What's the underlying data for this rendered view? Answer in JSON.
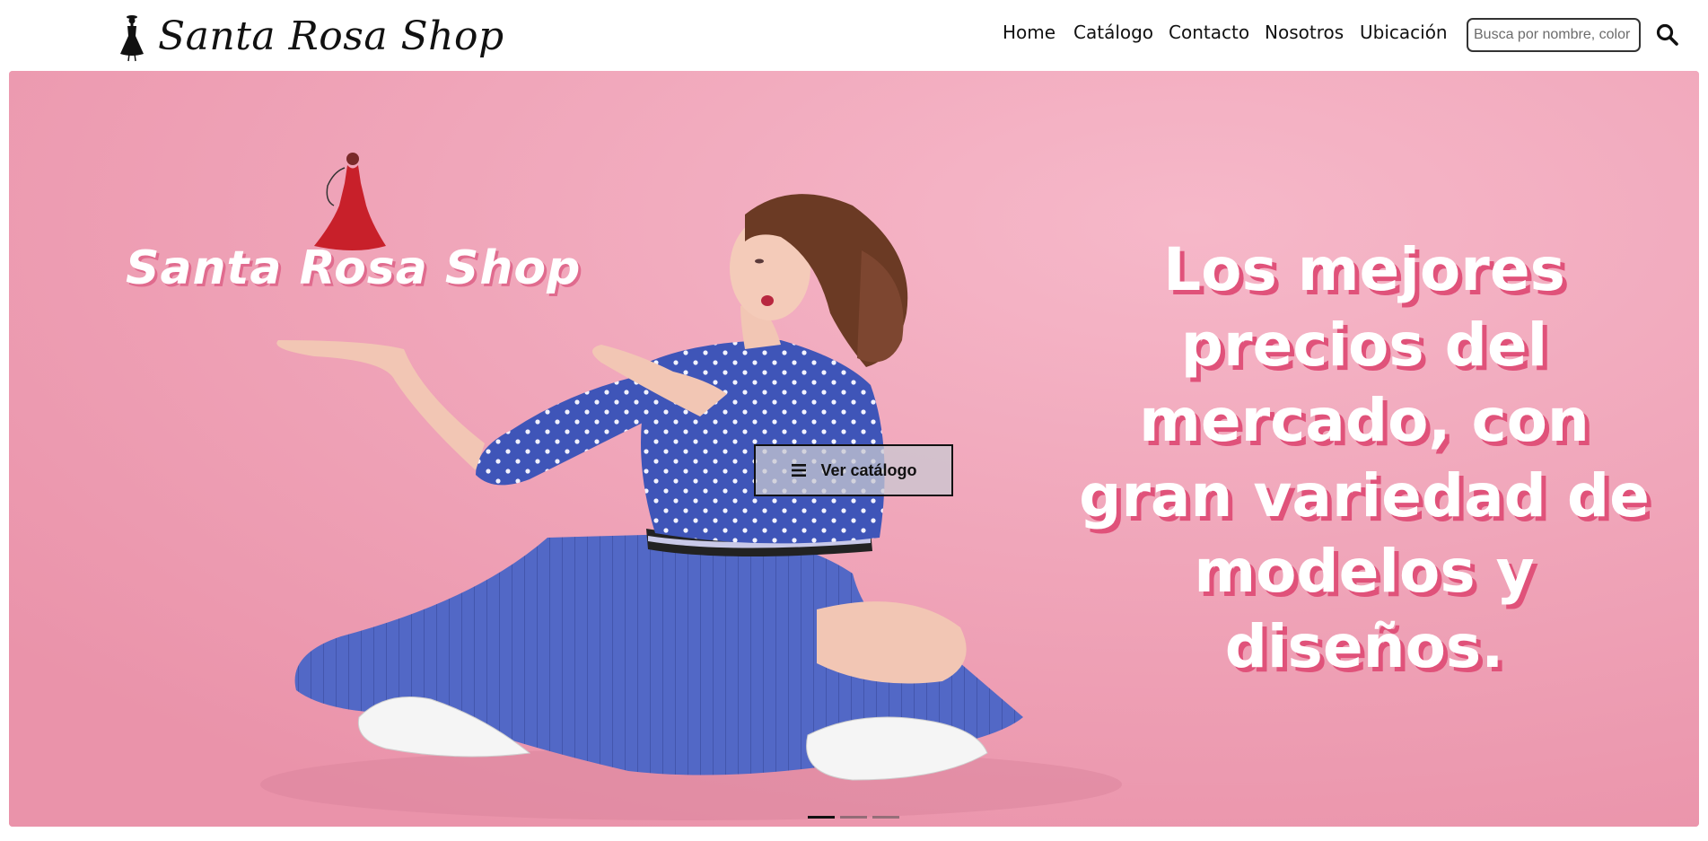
{
  "navbar": {
    "brand_name": "Santa Rosa Shop",
    "links": [
      "Home",
      "Catálogo",
      "Contacto",
      "Nosotros",
      "Ubicación"
    ],
    "search": {
      "placeholder": "Busca por nombre, color",
      "value": ""
    }
  },
  "hero": {
    "logo_text": "Santa Rosa Shop",
    "headline": "Los mejores precios del mercado, con gran variedad de modelos y diseños.",
    "cta_label": "Ver catálogo",
    "slide_count": 3,
    "active_slide": 1
  },
  "colors": {
    "hero_bg": "#f0a4b9",
    "headline_shadow": "#e0527a",
    "dress_red": "#c8202a",
    "blouse_blue": "#3f55b8",
    "skirt_blue": "#5268c6"
  },
  "icons": {
    "brand_logo": "woman-in-dress-icon",
    "search": "search-icon",
    "cta": "list-icon"
  }
}
